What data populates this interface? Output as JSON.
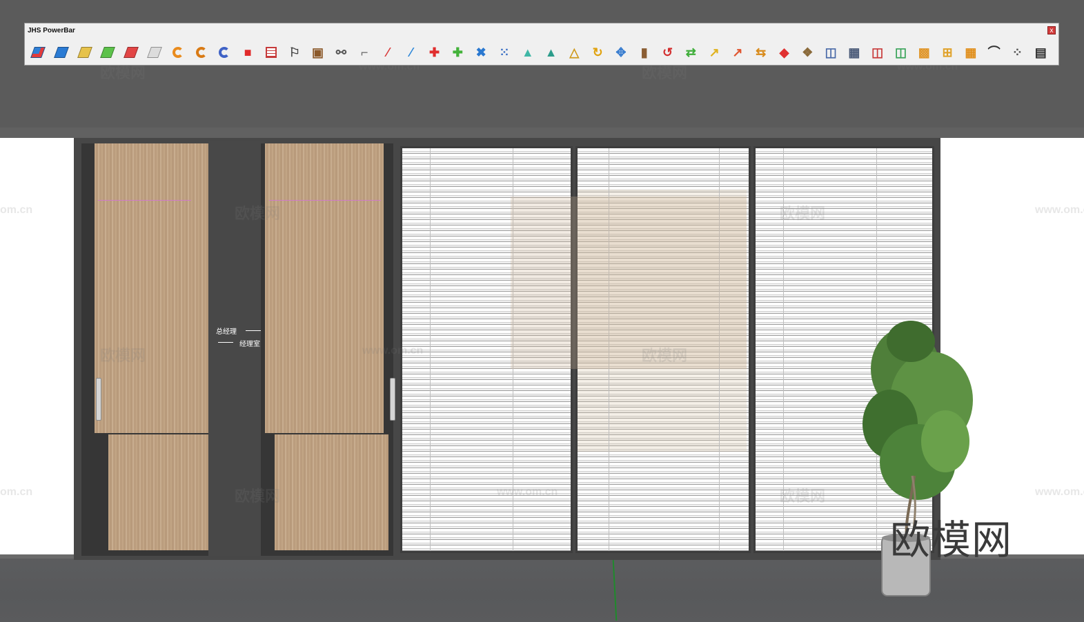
{
  "toolbar": {
    "title": "JHS PowerBar",
    "close_glyph": "x",
    "icons": [
      {
        "name": "blue-face-icon",
        "kind": "sq",
        "color": "#2f7fd6",
        "accent": "#e23b3b"
      },
      {
        "name": "blue-face-2-icon",
        "kind": "sq",
        "color": "#2a7bd4"
      },
      {
        "name": "yellow-face-icon",
        "kind": "sq",
        "color": "#e6c24a"
      },
      {
        "name": "green-face-icon",
        "kind": "sq",
        "color": "#5cc24a"
      },
      {
        "name": "red-face-icon",
        "kind": "sq",
        "color": "#e24545"
      },
      {
        "name": "grid-face-icon",
        "kind": "sq",
        "color": "#dcdcdc"
      },
      {
        "name": "orange-arc-icon",
        "kind": "ring",
        "color": "#e98b1d"
      },
      {
        "name": "orange-arc-2-icon",
        "kind": "ring",
        "color": "#d97a14"
      },
      {
        "name": "twist-icon",
        "kind": "ring",
        "color": "#3f62c6"
      },
      {
        "name": "red-square-icon",
        "kind": "glyph",
        "glyph": "■",
        "color": "#e12b2b"
      },
      {
        "name": "striped-square-icon",
        "kind": "bars",
        "color": "#c63a3a"
      },
      {
        "name": "flag-icon",
        "kind": "glyph",
        "glyph": "⚐",
        "color": "#444444"
      },
      {
        "name": "box-icon",
        "kind": "glyph",
        "glyph": "▣",
        "color": "#8c5a2b"
      },
      {
        "name": "link-icon",
        "kind": "glyph",
        "glyph": "⚯",
        "color": "#555555"
      },
      {
        "name": "corner-icon",
        "kind": "glyph",
        "glyph": "⌐",
        "color": "#666666"
      },
      {
        "name": "red-dots-icon",
        "kind": "glyph",
        "glyph": "⁄",
        "color": "#d83a3a"
      },
      {
        "name": "blue-dots-icon",
        "kind": "glyph",
        "glyph": "⁄",
        "color": "#2b86d9"
      },
      {
        "name": "red-cross-icon",
        "kind": "glyph",
        "glyph": "✚",
        "color": "#e02d2d"
      },
      {
        "name": "green-cross-icon",
        "kind": "glyph",
        "glyph": "✚",
        "color": "#43b23a"
      },
      {
        "name": "blue-x-icon",
        "kind": "glyph",
        "glyph": "✖",
        "color": "#2a78d0"
      },
      {
        "name": "dot-grid-icon",
        "kind": "glyph",
        "glyph": "⁙",
        "color": "#3a6fc4"
      },
      {
        "name": "cone-icon",
        "kind": "glyph",
        "glyph": "▲",
        "color": "#3fb7a6"
      },
      {
        "name": "cone-2-icon",
        "kind": "glyph",
        "glyph": "▲",
        "color": "#2c9c8b"
      },
      {
        "name": "triangle-icon",
        "kind": "glyph",
        "glyph": "△",
        "color": "#cf9a1d"
      },
      {
        "name": "rotate-icon",
        "kind": "glyph",
        "glyph": "↻",
        "color": "#e0a20f"
      },
      {
        "name": "move-icon",
        "kind": "glyph",
        "glyph": "✥",
        "color": "#3c7fd0"
      },
      {
        "name": "wood-block-icon",
        "kind": "glyph",
        "glyph": "▮",
        "color": "#8b5e34"
      },
      {
        "name": "undo-icon",
        "kind": "glyph",
        "glyph": "↺",
        "color": "#d32f2f"
      },
      {
        "name": "green-arrows-icon",
        "kind": "glyph",
        "glyph": "⇄",
        "color": "#3fae3a"
      },
      {
        "name": "yellow-arrow-icon",
        "kind": "glyph",
        "glyph": "↗",
        "color": "#e0b21f"
      },
      {
        "name": "red-arrow-icon",
        "kind": "glyph",
        "glyph": "↗",
        "color": "#e0552f"
      },
      {
        "name": "mixed-arrows-icon",
        "kind": "glyph",
        "glyph": "⇆",
        "color": "#d88a1a"
      },
      {
        "name": "red-tag-icon",
        "kind": "glyph",
        "glyph": "◆",
        "color": "#e03030"
      },
      {
        "name": "cubes-icon",
        "kind": "glyph",
        "glyph": "❖",
        "color": "#8a6a3a"
      },
      {
        "name": "frame-icon",
        "kind": "glyph",
        "glyph": "◫",
        "color": "#4a6aa8"
      },
      {
        "name": "mesh-icon",
        "kind": "glyph",
        "glyph": "▦",
        "color": "#4a5a78"
      },
      {
        "name": "red-frame-icon",
        "kind": "glyph",
        "glyph": "◫",
        "color": "#c83a3a"
      },
      {
        "name": "green-frame-icon",
        "kind": "glyph",
        "glyph": "◫",
        "color": "#3aa45a"
      },
      {
        "name": "orange-grid-icon",
        "kind": "glyph",
        "glyph": "▩",
        "color": "#e0962a"
      },
      {
        "name": "orange-grid-2-icon",
        "kind": "glyph",
        "glyph": "⊞",
        "color": "#e0a22a"
      },
      {
        "name": "orange-grid-3-icon",
        "kind": "glyph",
        "glyph": "▦",
        "color": "#e08e1a"
      },
      {
        "name": "dotted-curve-icon",
        "kind": "glyph",
        "glyph": "⌒",
        "color": "#333333"
      },
      {
        "name": "scatter-icon",
        "kind": "glyph",
        "glyph": "⁘",
        "color": "#555555"
      },
      {
        "name": "layout-icon",
        "kind": "glyph",
        "glyph": "▤",
        "color": "#2c2c2c"
      }
    ]
  },
  "scene": {
    "sign_top": "总经理",
    "sign_bottom": "经理室",
    "watermark_text": "欧模网",
    "watermark_url": "www.om.cn",
    "watermark_url_short": "om.cn",
    "big_watermark": "欧模网"
  }
}
